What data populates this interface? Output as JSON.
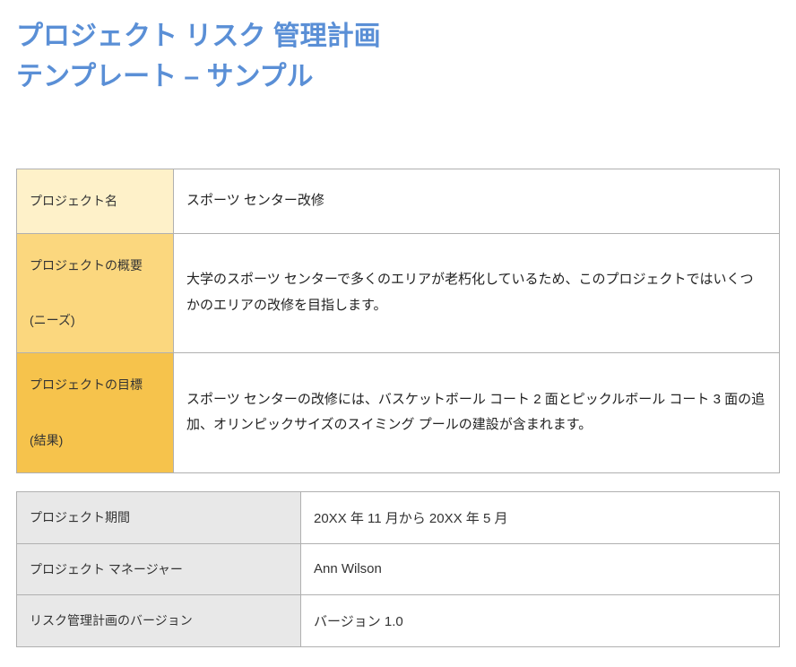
{
  "title_line1": "プロジェクト リスク 管理計画",
  "title_line2": "テンプレート – サンプル",
  "table1": {
    "rows": [
      {
        "label": "プロジェクト名",
        "value": "スポーツ センター改修"
      },
      {
        "label_line1": "プロジェクトの概要",
        "label_line2": "(ニーズ)",
        "value": "大学のスポーツ センターで多くのエリアが老朽化しているため、このプロジェクトではいくつかのエリアの改修を目指します。"
      },
      {
        "label_line1": "プロジェクトの目標",
        "label_line2": "(結果)",
        "value": "スポーツ センターの改修には、バスケットボール コート 2 面とピックルボール コート 3 面の追加、オリンピックサイズのスイミング プールの建設が含まれます。"
      }
    ]
  },
  "table2": {
    "rows": [
      {
        "label": "プロジェクト期間",
        "value": "20XX 年 11 月から 20XX 年 5 月"
      },
      {
        "label": "プロジェクト マネージャー",
        "value": "Ann Wilson"
      },
      {
        "label": "リスク管理計画のバージョン",
        "value": "バージョン 1.0"
      }
    ]
  }
}
